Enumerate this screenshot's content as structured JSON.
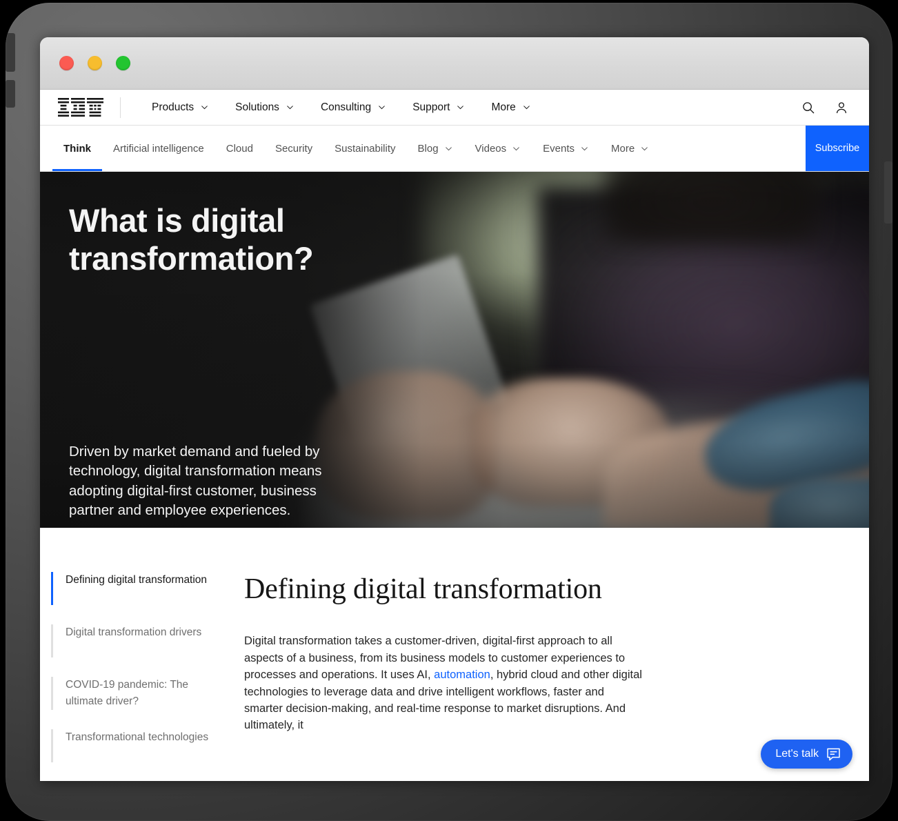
{
  "window": {
    "traffic_lights": [
      {
        "name": "close",
        "color": "#fb5b52"
      },
      {
        "name": "minimize",
        "color": "#f7bd2e"
      },
      {
        "name": "maximize",
        "color": "#23c530"
      }
    ]
  },
  "masthead": {
    "logo_text": "IBM",
    "nav": [
      {
        "label": "Products",
        "has_chevron": true
      },
      {
        "label": "Solutions",
        "has_chevron": true
      },
      {
        "label": "Consulting",
        "has_chevron": true
      },
      {
        "label": "Support",
        "has_chevron": true
      },
      {
        "label": "More",
        "has_chevron": true
      }
    ],
    "search_icon": "search-icon",
    "account_icon": "user-avatar-icon"
  },
  "subnav": {
    "items": [
      {
        "label": "Think",
        "has_chevron": false,
        "active": true
      },
      {
        "label": "Artificial intelligence",
        "has_chevron": false,
        "active": false
      },
      {
        "label": "Cloud",
        "has_chevron": false,
        "active": false
      },
      {
        "label": "Security",
        "has_chevron": false,
        "active": false
      },
      {
        "label": "Sustainability",
        "has_chevron": false,
        "active": false
      },
      {
        "label": "Blog",
        "has_chevron": true,
        "active": false
      },
      {
        "label": "Videos",
        "has_chevron": true,
        "active": false
      },
      {
        "label": "Events",
        "has_chevron": true,
        "active": false
      },
      {
        "label": "More",
        "has_chevron": true,
        "active": false
      }
    ],
    "subscribe_label": "Subscribe",
    "active_indicator_color": "#0f62fe",
    "subscribe_color": "#0f62fe"
  },
  "hero": {
    "title": "What is digital transformation?",
    "subtitle": "Driven by market demand and fueled by technology, digital transformation means adopting digital-first customer, business partner and employee experiences.",
    "background_description": "Person in dark sweater with denim sleeves holding a tablet near a bright window"
  },
  "article": {
    "toc": [
      {
        "label": "Defining digital transformation",
        "active": true
      },
      {
        "label": "Digital transformation drivers",
        "active": false
      },
      {
        "label": "COVID-19 pandemic: The ultimate driver?",
        "active": false
      },
      {
        "label": "Transformational technologies",
        "active": false
      }
    ],
    "heading": "Defining digital transformation",
    "paragraph_part1": "Digital transformation takes a customer-driven, digital-first approach to all aspects of a business, from its business models to customer experiences to processes and operations. It uses AI, ",
    "paragraph_link": "automation",
    "paragraph_part2": ", hybrid cloud and other digital technologies to leverage data and drive intelligent workflows, faster and smarter decision-making, and real-time response to market disruptions. And ultimately, it"
  },
  "chat_widget": {
    "label": "Let's talk",
    "icon": "chat-bubble-icon",
    "color": "#1f62f2"
  }
}
